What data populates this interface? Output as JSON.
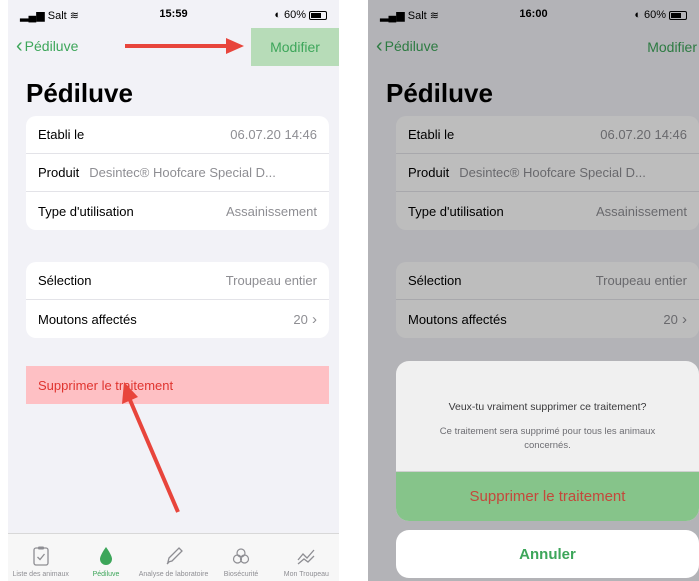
{
  "status_left": {
    "carrier": "Salt",
    "time": "15:59",
    "battery": "60%"
  },
  "status_right": {
    "carrier": "Salt",
    "time": "16:00",
    "battery": "60%"
  },
  "nav": {
    "back_label": "Pédiluve",
    "modify_label": "Modifier"
  },
  "page_title": "Pédiluve",
  "details": {
    "established_label": "Etabli le",
    "established_value": "06.07.20 14:46",
    "product_label": "Produit",
    "product_value": "Desintec® Hoofcare Special D...",
    "usage_label": "Type d'utilisation",
    "usage_value": "Assainissement"
  },
  "selection": {
    "selection_label": "Sélection",
    "selection_value": "Troupeau entier",
    "affected_label": "Moutons affectés",
    "affected_value": "20"
  },
  "delete_label": "Supprimer le traitement",
  "tabs": [
    {
      "label": "Liste des animaux",
      "icon": "clipboard-check-icon"
    },
    {
      "label": "Pédiluve",
      "icon": "drop-icon"
    },
    {
      "label": "Analyse de laboratoire",
      "icon": "pipette-icon"
    },
    {
      "label": "Biosécurité",
      "icon": "biohazard-icon"
    },
    {
      "label": "Mon Troupeau",
      "icon": "chart-icon"
    }
  ],
  "dialog": {
    "question": "Veux-tu vraiment supprimer ce traitement?",
    "description": "Ce traitement sera supprimé pour tous les animaux concernés.",
    "confirm_label": "Supprimer le traitement",
    "cancel_label": "Annuler"
  },
  "colors": {
    "accent": "#3da65a",
    "destructive": "#e0342f",
    "highlight_green": "#b7dcb8",
    "highlight_red": "#fec0c4",
    "arrow": "#e8453c"
  }
}
